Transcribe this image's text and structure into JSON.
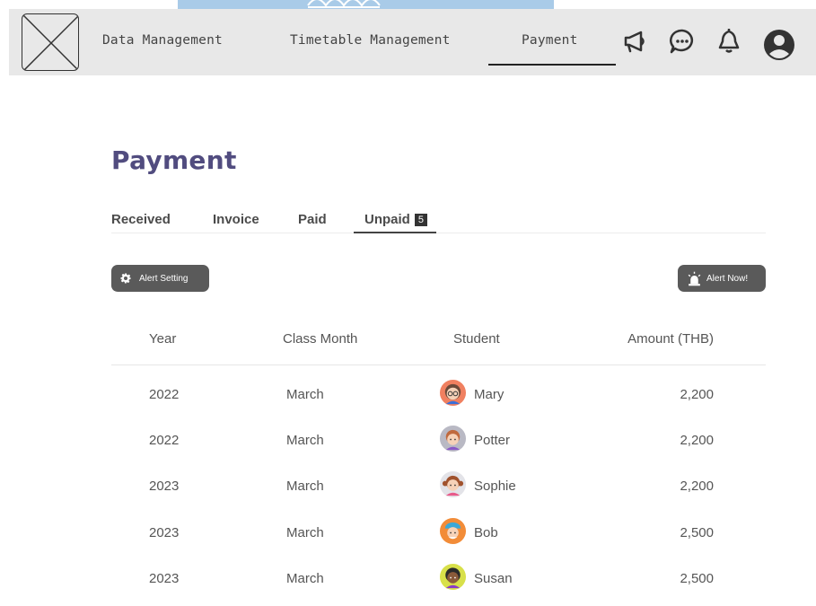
{
  "nav": {
    "items": [
      "Data Management",
      "Timetable Management",
      "Payment"
    ],
    "active": "Payment",
    "icons": [
      "megaphone-icon",
      "chat-icon",
      "bell-icon",
      "user-icon"
    ]
  },
  "page": {
    "title": "Payment"
  },
  "tabs": {
    "items": [
      {
        "label": "Received"
      },
      {
        "label": "Invoice"
      },
      {
        "label": "Paid"
      },
      {
        "label": "Unpaid",
        "badge": "5"
      }
    ],
    "active": "Unpaid"
  },
  "actions": {
    "alert_setting": "Alert Setting",
    "alert_now": "Alert Now!"
  },
  "table": {
    "headers": {
      "year": "Year",
      "month": "Class Month",
      "student": "Student",
      "amount": "Amount (THB)"
    },
    "rows": [
      {
        "year": "2022",
        "month": "March",
        "student": "Mary",
        "amount": "2,200",
        "avatar": "girl-glasses-avatar"
      },
      {
        "year": "2022",
        "month": "March",
        "student": "Potter",
        "amount": "2,200",
        "avatar": "boy-avatar"
      },
      {
        "year": "2023",
        "month": "March",
        "student": "Sophie",
        "amount": "2,200",
        "avatar": "girl-pigtails-avatar"
      },
      {
        "year": "2023",
        "month": "March",
        "student": "Bob",
        "amount": "2,500",
        "avatar": "boy-cap-avatar"
      },
      {
        "year": "2023",
        "month": "March",
        "student": "Susan",
        "amount": "2,500",
        "avatar": "girl-dark-avatar"
      }
    ]
  },
  "colors": {
    "navbar": "#e8e8e8",
    "title": "#514c7f",
    "button": "#5a5a5a",
    "top_strip": "#a9cbe8"
  }
}
